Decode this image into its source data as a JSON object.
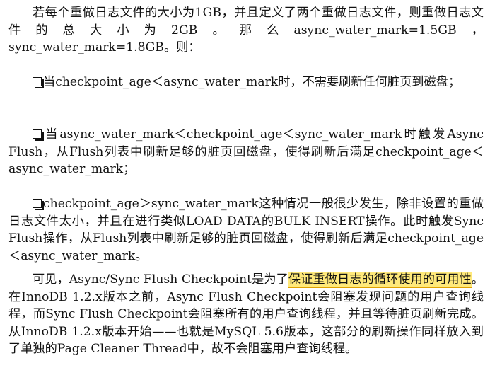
{
  "paragraphs": {
    "p1": "若每个重做日志文件的大小为1GB，并且定义了两个重做日志文件，则重做日志文件的总大小为2GB。那么async_water_mark=1.5GB，sync_water_mark=1.8GB。则：",
    "p2": "当checkpoint_age＜async_water_mark时，不需要刷新任何脏页到磁盘；",
    "p3": "当async_water_mark＜checkpoint_age＜sync_water_mark时触发Async Flush，从Flush列表中刷新足够的脏页回磁盘，使得刷新后满足checkpoint_age＜async_water_mark；",
    "p4": "checkpoint_age＞sync_water_mark这种情况一般很少发生，除非设置的重做日志文件太小，并且在进行类似LOAD DATA的BULK INSERT操作。此时触发Sync Flush操作，从Flush列表中刷新足够的脏页回磁盘，使得刷新后满足checkpoint_age＜async_water_mark。",
    "p5_before": "可见，Async/Sync Flush Checkpoint是为了",
    "p5_highlight": "保证重做日志的循环使用的可用性",
    "p5_after": "。在InnoDB 1.2.x版本之前，Async Flush Checkpoint会阻塞发现问题的用户查询线程，而Sync Flush Checkpoint会阻塞所有的用户查询线程，并且等待脏页刷新完成。从InnoDB 1.2.x版本开始——也就是MySQL 5.6版本，这部分的刷新操作同样放入到了单独的Page Cleaner Thread中，故不会阻塞用户查询线程。"
  },
  "icons": {
    "bullet": "checkbox-icon"
  },
  "colors": {
    "highlight_fill": "#ffe97a",
    "highlight_underline": "#e0a200",
    "text": "#111111"
  }
}
